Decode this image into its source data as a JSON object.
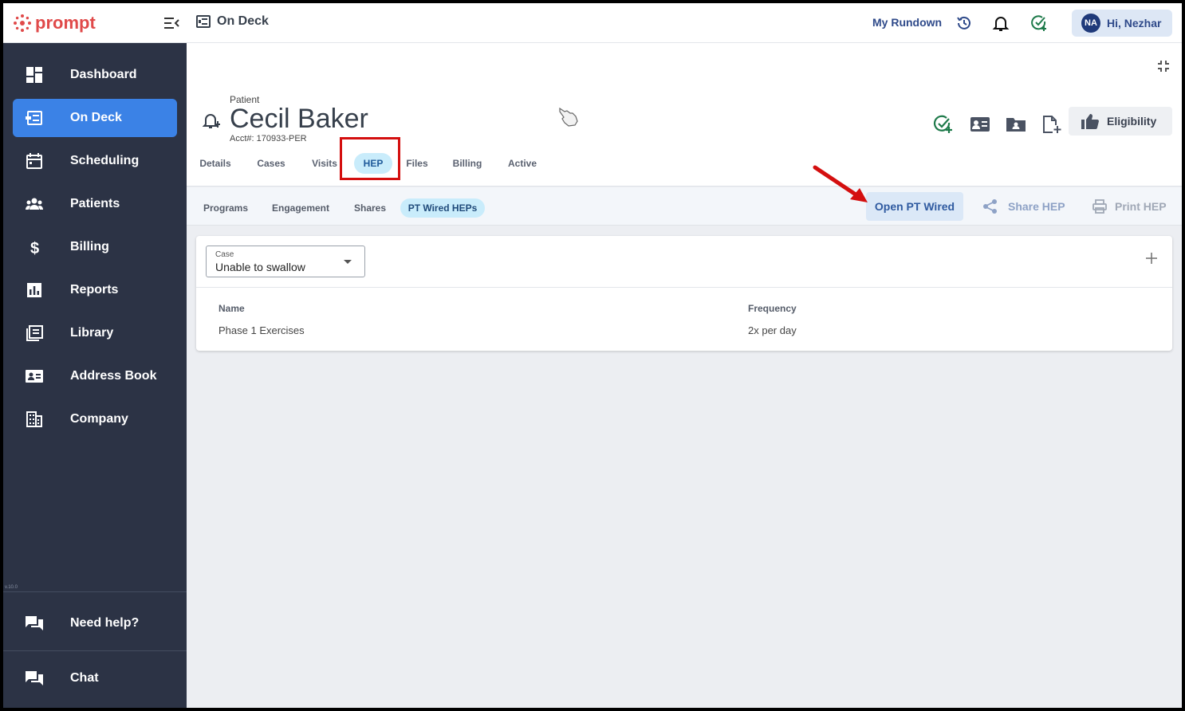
{
  "app": {
    "logo_text": "prompt",
    "page_title": "On Deck"
  },
  "topbar": {
    "rundown_label": "My Rundown",
    "user_initials": "NA",
    "user_greeting": "Hi, Nezhar"
  },
  "sidebar": {
    "items": [
      {
        "label": "Dashboard",
        "icon": "dashboard-icon"
      },
      {
        "label": "On Deck",
        "icon": "on-deck-icon",
        "active": true
      },
      {
        "label": "Scheduling",
        "icon": "calendar-icon"
      },
      {
        "label": "Patients",
        "icon": "people-icon"
      },
      {
        "label": "Billing",
        "icon": "dollar-icon"
      },
      {
        "label": "Reports",
        "icon": "bar-chart-icon"
      },
      {
        "label": "Library",
        "icon": "library-icon"
      },
      {
        "label": "Address Book",
        "icon": "contact-card-icon"
      },
      {
        "label": "Company",
        "icon": "building-icon"
      }
    ],
    "version": "v.10.0",
    "help_label": "Need help?",
    "chat_label": "Chat"
  },
  "patient": {
    "label": "Patient",
    "name": "Cecil Baker",
    "acct": "Acct#: 170933-PER"
  },
  "header_actions": {
    "eligibility_label": "Eligibility"
  },
  "tabs": [
    {
      "label": "Details"
    },
    {
      "label": "Cases"
    },
    {
      "label": "Visits"
    },
    {
      "label": "HEP",
      "active": true
    },
    {
      "label": "Files"
    },
    {
      "label": "Billing"
    },
    {
      "label": "Active"
    }
  ],
  "subtabs": [
    {
      "label": "Programs"
    },
    {
      "label": "Engagement"
    },
    {
      "label": "Shares"
    },
    {
      "label": "PT Wired HEPs",
      "active": true
    }
  ],
  "actions": {
    "open_pt_wired": "Open PT Wired",
    "share_hep": "Share HEP",
    "print_hep": "Print HEP"
  },
  "case_select": {
    "label": "Case",
    "value": "Unable to swallow"
  },
  "table": {
    "headers": [
      "Name",
      "Frequency"
    ],
    "rows": [
      [
        "Phase 1 Exercises",
        "2x per day"
      ]
    ]
  },
  "colors": {
    "sidebar_bg": "#2c3345",
    "active_nav": "#3b82e6",
    "tab_active_bg": "#c9ecfb",
    "highlight_red": "#d40f0f",
    "brand_red": "#e04a4a"
  }
}
